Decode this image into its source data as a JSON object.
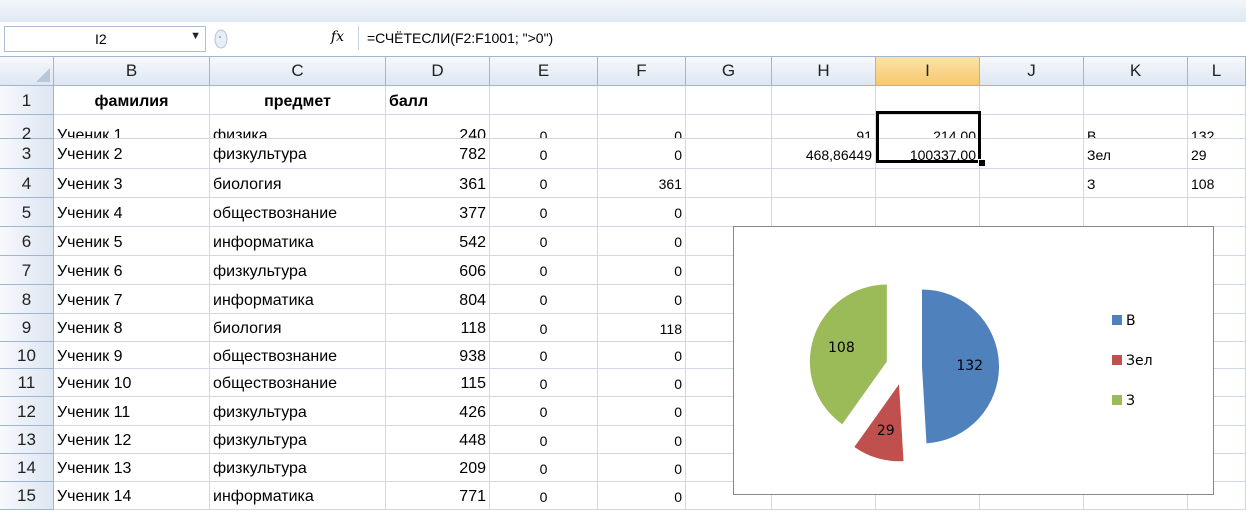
{
  "formula_bar": {
    "name_box": "I2",
    "fx_label": "fx",
    "formula": "=СЧЁТЕСЛИ(F2:F1001; \">0\")"
  },
  "columns": [
    "B",
    "C",
    "D",
    "E",
    "F",
    "G",
    "H",
    "I",
    "J",
    "K",
    "L"
  ],
  "selected_column": "I",
  "rows": [
    {
      "n": "1",
      "B": "фамилия",
      "C": "предмет",
      "D": "балл",
      "E": "",
      "F": "",
      "H": "",
      "I": "",
      "K": "",
      "L": ""
    },
    {
      "n": "2",
      "B": "Ученик 1",
      "C": "физика",
      "D": "240",
      "E": "0",
      "F": "0",
      "H": "91",
      "I": "214,00",
      "K": "В",
      "L": "132"
    },
    {
      "n": "3",
      "B": "Ученик 2",
      "C": "физкультура",
      "D": "782",
      "E": "0",
      "F": "0",
      "H": "468,86449",
      "I": "100337,00",
      "K": "Зел",
      "L": "29"
    },
    {
      "n": "4",
      "B": "Ученик 3",
      "C": "биология",
      "D": "361",
      "E": "0",
      "F": "361",
      "H": "",
      "I": "",
      "K": "З",
      "L": "108"
    },
    {
      "n": "5",
      "B": "Ученик 4",
      "C": "обществознание",
      "D": "377",
      "E": "0",
      "F": "0"
    },
    {
      "n": "6",
      "B": "Ученик 5",
      "C": "информатика",
      "D": "542",
      "E": "0",
      "F": "0"
    },
    {
      "n": "7",
      "B": "Ученик 6",
      "C": "физкультура",
      "D": "606",
      "E": "0",
      "F": "0"
    },
    {
      "n": "8",
      "B": "Ученик 7",
      "C": "информатика",
      "D": "804",
      "E": "0",
      "F": "0"
    },
    {
      "n": "9",
      "B": "Ученик 8",
      "C": "биология",
      "D": "118",
      "E": "0",
      "F": "118"
    },
    {
      "n": "10",
      "B": "Ученик 9",
      "C": "обществознание",
      "D": "938",
      "E": "0",
      "F": "0"
    },
    {
      "n": "11",
      "B": "Ученик 10",
      "C": "обществознание",
      "D": "115",
      "E": "0",
      "F": "0"
    },
    {
      "n": "12",
      "B": "Ученик 11",
      "C": "физкультура",
      "D": "426",
      "E": "0",
      "F": "0"
    },
    {
      "n": "13",
      "B": "Ученик 12",
      "C": "физкультура",
      "D": "448",
      "E": "0",
      "F": "0"
    },
    {
      "n": "14",
      "B": "Ученик 13",
      "C": "физкультура",
      "D": "209",
      "E": "0",
      "F": "0"
    },
    {
      "n": "15",
      "B": "Ученик 14",
      "C": "информатика",
      "D": "771",
      "E": "0",
      "F": "0"
    }
  ],
  "chart_data": {
    "type": "pie",
    "exploded": true,
    "legend_position": "right",
    "slices": [
      {
        "label": "В",
        "value": 132,
        "color": "#4f81bd"
      },
      {
        "label": "Зел",
        "value": 29,
        "color": "#c0504d"
      },
      {
        "label": "З",
        "value": 108,
        "color": "#9bbb59"
      }
    ]
  }
}
